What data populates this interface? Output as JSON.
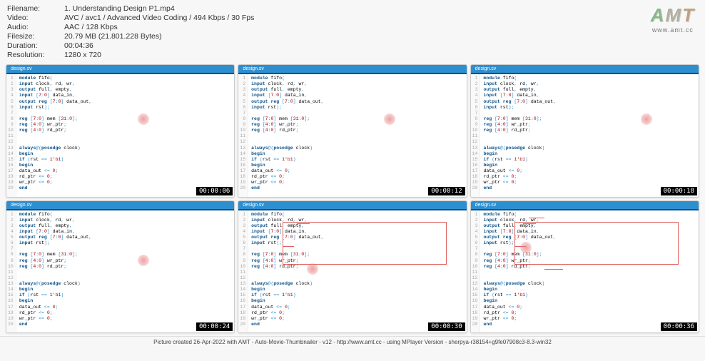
{
  "meta": {
    "filename_label": "Filename:",
    "filename_value": "1. Understanding Design P1.mp4",
    "video_label": "Video:",
    "video_value": "AVC / avc1 / Advanced Video Coding / 494 Kbps / 30 Fps",
    "audio_label": "Audio:",
    "audio_value": "AAC / 128 Kbps",
    "filesize_label": "Filesize:",
    "filesize_value": "20.79 MB (21.801.228 Bytes)",
    "duration_label": "Duration:",
    "duration_value": "00:04:36",
    "resolution_label": "Resolution:",
    "resolution_value": "1280 x 720"
  },
  "logo": {
    "letters": [
      "A",
      "M",
      "T"
    ],
    "sub": "www.amt.cc"
  },
  "thumb_title": "design.sv",
  "code": {
    "lines": [
      "module fifo(",
      "input clock, rd, wr,",
      "output full, empty,",
      "input [7:0] data_in,",
      "output reg [7:0] data_out,",
      "input rst);",
      "",
      "reg [7:0] mem [31:0];",
      "reg [4:0] wr_ptr;",
      "reg [4:0] rd_ptr;",
      "",
      "",
      "always@(posedge clock)",
      "begin",
      "  if (rst == 1'b1)",
      "    begin",
      "      data_out <= 0;",
      "      rd_ptr <= 0;",
      "      wr_ptr <= 0;",
      "    end"
    ]
  },
  "thumbs": [
    {
      "ts": "00:00:06"
    },
    {
      "ts": "00:00:12"
    },
    {
      "ts": "00:00:18"
    },
    {
      "ts": "00:00:24"
    },
    {
      "ts": "00:00:30"
    },
    {
      "ts": "00:00:36"
    }
  ],
  "footer": "Picture created 26-Apr-2022 with AMT - Auto-Movie-Thumbnailer - v12 - http://www.amt.cc - using MPlayer Version - sherpya-r38154+g9fe07908c3-8.3-win32"
}
